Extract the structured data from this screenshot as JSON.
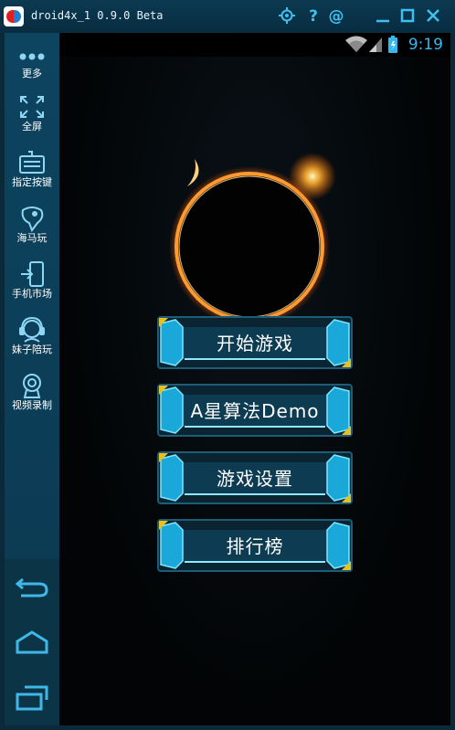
{
  "window": {
    "title": "droid4x_1 0.9.0 Beta",
    "icons": [
      "gear-icon",
      "help-icon",
      "at-icon",
      "minimize-icon",
      "maximize-icon",
      "close-icon"
    ]
  },
  "sidebar": {
    "items": [
      {
        "label": "更多",
        "icon": "more-dots-icon"
      },
      {
        "label": "全屏",
        "icon": "fullscreen-icon"
      },
      {
        "label": "指定按键",
        "icon": "keyboard-icon"
      },
      {
        "label": "海马玩",
        "icon": "seahorse-icon"
      },
      {
        "label": "手机市场",
        "icon": "phone-market-icon"
      },
      {
        "label": "妹子陪玩",
        "icon": "headset-girl-icon"
      },
      {
        "label": "视频录制",
        "icon": "camera-record-icon"
      }
    ],
    "nav": [
      "back-icon",
      "home-icon",
      "recent-apps-icon"
    ]
  },
  "statusbar": {
    "time": "9:19",
    "icons": [
      "wifi-icon",
      "signal-icon",
      "battery-icon"
    ]
  },
  "game": {
    "menu": [
      {
        "label": "开始游戏"
      },
      {
        "label": "A星算法Demo"
      },
      {
        "label": "游戏设置"
      },
      {
        "label": "排行榜"
      }
    ]
  },
  "colors": {
    "accent": "#34b8ef",
    "titlebar": "#0b3a52",
    "sidebar": "#0d4460",
    "button_glow": "#1ac8f0"
  }
}
